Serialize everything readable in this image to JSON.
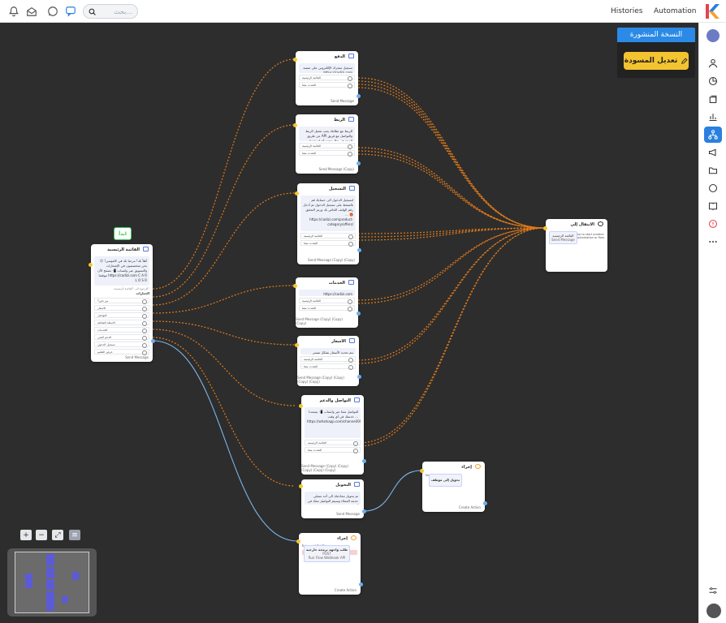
{
  "topbar": {
    "search_placeholder": "بحث...",
    "links": [
      "Histories",
      "Automation"
    ]
  },
  "publish": {
    "label": "النسخة المنشورة",
    "edit_label": "تعديل المسودة"
  },
  "start_label": "ابدأ",
  "nodes": {
    "main": {
      "title": "القائمة الرئيسية",
      "body": "أهلاً بك! مرحبا بك في كاغوسي! 😊 نحن متخصصون في الإشعارات والتسويق عبر واتساب 📲 تصفح الأن موقعنا https://cadizi.com C A R L O S R",
      "note": "للرجوع الى \"القائمة الرئيسية\"",
      "section": "الخيارات",
      "options": [
        "من نحن؟",
        "الاسعار",
        "التواصل",
        "الاسئلة الشائعة",
        "الخدمات",
        "الدعم الفني",
        "تسجيل الدخول",
        "عرض التعليم"
      ],
      "footer": "Send Message"
    },
    "n1": {
      "title": "الدفع",
      "body": "تسجيل متجرك الإلكتروني على منصة https://cadizi.com",
      "options": [
        "القائمة الرئيسية",
        "التحدث معنا"
      ],
      "footer": "Send Message"
    },
    "n2": {
      "title": "الربط",
      "body": "للربط مع نظامك يجب تفعيل الربط عن طريق API والتواصل مع فريق الدعم في حال وجود أي استفسار",
      "options": [
        "القائمة الرئيسية",
        "التحدث معنا"
      ],
      "footer": "Send Message (Copy)"
    },
    "n3": {
      "title": "التسجيل",
      "body": "لتسجيل الدخول الى حسابك قم بالضغط على تسجيل الدخول ثم أدخل رقم الهاتف الخاص بك ورمز التحقق ... 🎁 https://cadizi.com/product-category/offers/",
      "options": [
        "القائمة الرئيسية",
        "التحدث معنا"
      ],
      "footer": "Send Message (Copy) (Copy)"
    },
    "n4": {
      "title": "الخدمات",
      "body": "https://cadizi.com",
      "options": [
        "القائمة الرئيسية",
        "التحدث معنا"
      ],
      "footer": "Send Message (Copy) (Copy) (Copy)"
    },
    "n5": {
      "title": "الاسعار",
      "body": "يتم تحديد الأسعار بشكل ميسر للعملاء",
      "options": [
        "القائمة الرئيسية",
        "التحدث معنا"
      ],
      "footer": "Send Message (Copy) (Copy) (Copy) (Copy)"
    },
    "n6": {
      "title": "التواصل والدعم",
      "body": "للتواصل معنا عبر واتساب 📲 يسعدنا خدمتك في أي وقت ... https://whatsapp.com/channel/0029Va8YE58BlsviqY1hM80x",
      "options": [
        "القائمة الرئيسية",
        "التحدث معنا"
      ],
      "footer": "Send Message (Copy) (Copy) (Copy) (Copy) (Copy)"
    },
    "n7": {
      "title": "التحويل",
      "body": "تم تحويل محادثتك الى أحد ممثلي خدمة العملاء وسيتم التواصل معك في أقرب وقت",
      "footer": "Send Message"
    },
    "jump": {
      "title": "الانتقال إلى",
      "inner_title": "القائمة الرئيسية",
      "inner_sub": "Send Message",
      "note": "Run another step to start another automation or flow"
    },
    "agent": {
      "title": "إجراء",
      "inner_title": "تحويل إلى موظف",
      "desc": "No description provided",
      "footer": "Create Action"
    },
    "api": {
      "title": "إجراء",
      "inner_title": "طلب واجهة برمجة خارجية",
      "inner_sub": "POST",
      "inner_sub2": "Run Flow Webhook API",
      "label": "External API URL",
      "alert": "تم الحذف",
      "footer": "Create Action"
    }
  },
  "colors": {
    "accent": "#2b8ae6",
    "edge_orange": "#e07a1a",
    "edge_blue": "#7eb6e6",
    "edit_yellow": "#f4c430"
  },
  "zoom_controls": [
    "+",
    "−",
    "⤢",
    "≡"
  ]
}
